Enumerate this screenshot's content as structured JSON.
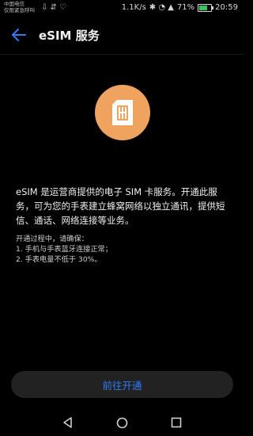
{
  "status_bar": {
    "carrier_line1": "中国电信",
    "carrier_line2": "仅限紧急呼叫",
    "left_icons": "⇩ ⇵ ♡",
    "speed": "1.1K/s",
    "right_icons": "✱ ◔ ▲",
    "battery_percent": "71%",
    "battery_level": 0.71,
    "battery_color": "#35c35a",
    "time": "20:59"
  },
  "appbar": {
    "back_icon": "arrow-left",
    "title": "eSIM 服务",
    "accent_color": "#2f7bf3"
  },
  "hero": {
    "icon": "sim-card-icon",
    "bg_color": "#f0a35f"
  },
  "description": "eSIM 是运营商提供的电子 SIM 卡服务。开通此服务，可为您的手表建立蜂窝网络以独立通讯，提供短信、通话、网络连接等业务。",
  "process": {
    "heading": "开通过程中，请确保：",
    "items": [
      "1. 手机与手表蓝牙连接正常；",
      "2. 手表电量不低于 30%。"
    ]
  },
  "cta": {
    "label": "前往开通"
  },
  "navbar": {
    "back": "triangle-back-icon",
    "home": "circle-home-icon",
    "recents": "square-recents-icon"
  }
}
